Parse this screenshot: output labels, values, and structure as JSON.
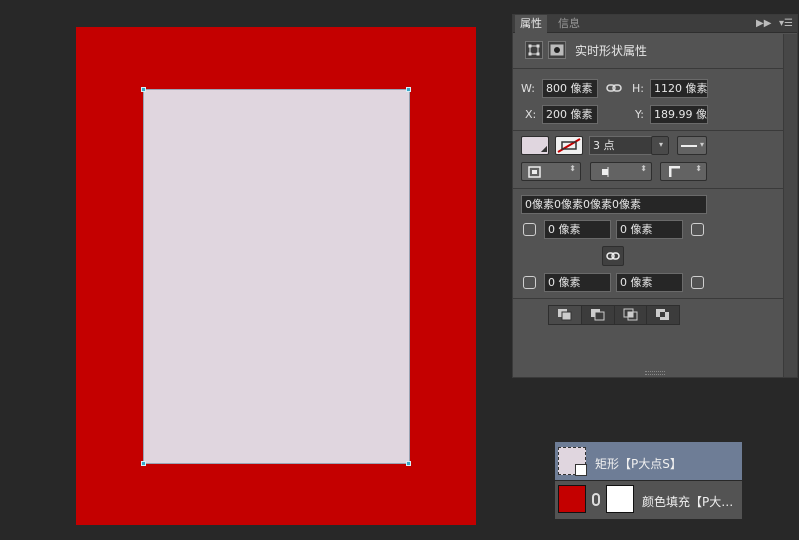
{
  "panel": {
    "tabs": [
      "属性",
      "信息"
    ],
    "header_title": "实时形状属性",
    "w_label": "W:",
    "w_value": "800 像素",
    "h_label": "H:",
    "h_value": "1120 像素",
    "x_label": "X:",
    "x_value": "200 像素",
    "y_label": "Y:",
    "y_value": "189.99 像",
    "stroke_width": "3 点",
    "corner_all": "0像素0像素0像素0像素",
    "corner_tl": "0 像素",
    "corner_tr": "0 像素",
    "corner_bl": "0 像素",
    "corner_br": "0 像素"
  },
  "layers": [
    {
      "name": "矩形【P大点S】",
      "selected": true
    },
    {
      "name": "颜色填充【P大…",
      "selected": false
    }
  ],
  "colors": {
    "canvas_red": "#c40000",
    "shape_fill": "#e0d6df",
    "selection": "#6e7d96"
  }
}
